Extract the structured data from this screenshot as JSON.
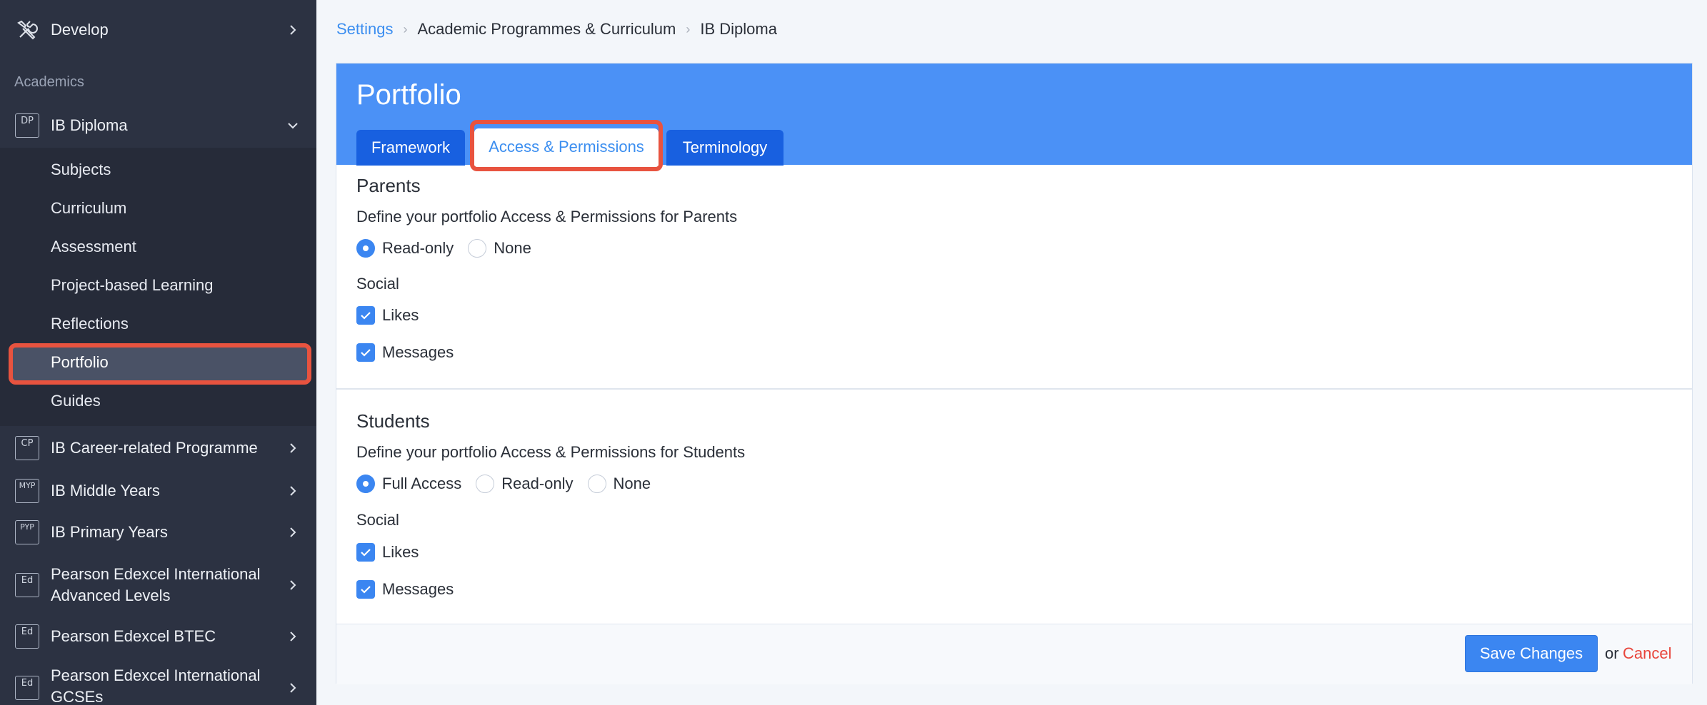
{
  "sidebar": {
    "develop": "Develop",
    "section_academics": "Academics",
    "ib_diploma": {
      "badge": "DP",
      "label": "IB Diploma"
    },
    "sub_items": [
      "Subjects",
      "Curriculum",
      "Assessment",
      "Project-based Learning",
      "Reflections",
      "Portfolio",
      "Guides"
    ],
    "programmes": [
      {
        "badge": "CP",
        "label": "IB Career-related Programme"
      },
      {
        "badge": "MYP",
        "label": "IB Middle Years"
      },
      {
        "badge": "PYP",
        "label": "IB Primary Years"
      },
      {
        "badge": "Ed",
        "label_line1": "Pearson Edexcel International",
        "label_line2": "Advanced Levels"
      },
      {
        "badge": "Ed",
        "label": "Pearson Edexcel BTEC"
      },
      {
        "badge": "Ed",
        "label_line1": "Pearson Edexcel International",
        "label_line2": "GCSEs"
      }
    ]
  },
  "breadcrumb": [
    "Settings",
    "Academic Programmes & Curriculum",
    "IB Diploma"
  ],
  "card": {
    "title": "Portfolio",
    "tabs": [
      "Framework",
      "Access & Permissions",
      "Terminology"
    ],
    "active_tab": "Access & Permissions"
  },
  "parents": {
    "title": "Parents",
    "description": "Define your portfolio Access & Permissions for Parents",
    "options": [
      "Read-only",
      "None"
    ],
    "selected": "Read-only",
    "social_label": "Social",
    "social": [
      {
        "label": "Likes",
        "checked": true
      },
      {
        "label": "Messages",
        "checked": true
      }
    ]
  },
  "students": {
    "title": "Students",
    "description": "Define your portfolio Access & Permissions for Students",
    "options": [
      "Full Access",
      "Read-only",
      "None"
    ],
    "selected": "Full Access",
    "social_label": "Social",
    "social": [
      {
        "label": "Likes",
        "checked": true
      },
      {
        "label": "Messages",
        "checked": true
      }
    ]
  },
  "footer": {
    "save": "Save Changes",
    "or": "or",
    "cancel": "Cancel"
  },
  "colors": {
    "accent": "#3b86f1",
    "header": "#4b91f6",
    "tab": "#1860e0",
    "highlight": "#e8533f",
    "sidebar": "#2c3242",
    "cancel": "#e8453b"
  }
}
